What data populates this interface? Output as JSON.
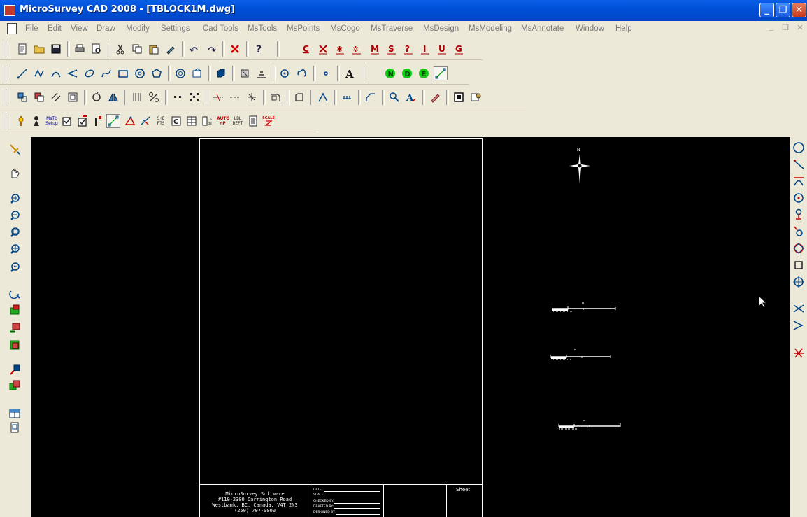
{
  "window": {
    "title": "MicroSurvey CAD 2008 - [TBLOCK1M.dwg]",
    "minimize_glyph": "_",
    "maximize_glyph": "❐",
    "close_glyph": "✕",
    "accent_color": "#0a5fe6"
  },
  "menubar": {
    "items": [
      "File",
      "Edit",
      "View",
      "Draw",
      "Modify",
      "Settings",
      "Cad Tools",
      "MsTools",
      "MsPoints",
      "MsCogo",
      "MsTraverse",
      "MsDesign",
      "MsModeling",
      "MsAnnotate",
      "Window",
      "Help"
    ],
    "mdi_min": "_",
    "mdi_restore": "❐",
    "mdi_close": "✕"
  },
  "toolbar4": {
    "mstb_setup": "MsTb Setup",
    "pts_label": "S+E PTS",
    "auto_p": "AUTO +P",
    "lbl_deft": "LBL DEFT",
    "scale_label": "SCALE"
  },
  "drawing": {
    "title_block": {
      "company_lines": [
        "MicroSurvey Software",
        "#110-2300 Carrington Road",
        "Westbank, BC, Canada, V4T 2N3",
        "(250) 707-0000"
      ],
      "fields": [
        "DATE:",
        "SCALE:",
        "CHECKED BY:",
        "DRAFTED BY:",
        "DESIGNED BY:"
      ],
      "sheet_label": "Sheet"
    },
    "north_label": "N"
  }
}
